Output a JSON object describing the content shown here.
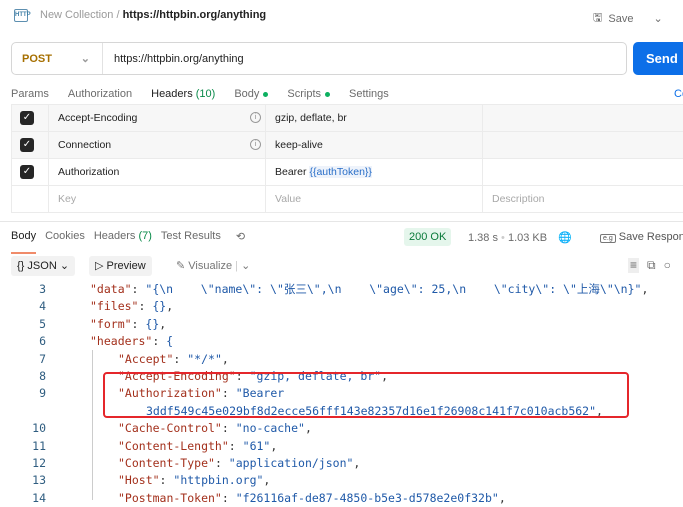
{
  "header": {
    "collection": "New Collection",
    "separator": "/",
    "request_name": "https://httpbin.org/anything",
    "save_label": "Save",
    "http_badge": "HTTP"
  },
  "request": {
    "method": "POST",
    "url": "https://httpbin.org/anything",
    "send_label": "Send"
  },
  "req_tabs": [
    {
      "label": "Params"
    },
    {
      "label": "Authorization"
    },
    {
      "label": "Headers",
      "count": "(10)"
    },
    {
      "label": "Body"
    },
    {
      "label": "Scripts"
    },
    {
      "label": "Settings"
    }
  ],
  "cookies_label": "Co",
  "headers_table": {
    "rows": [
      {
        "key": "Accept-Encoding",
        "value": "gzip, deflate, br"
      },
      {
        "key": "Connection",
        "value": "keep-alive"
      },
      {
        "key": "Authorization",
        "value": "Bearer",
        "variable": "{{authToken}}"
      }
    ],
    "placeholder": {
      "key": "Key",
      "value": "Value",
      "description": "Description"
    }
  },
  "resp_tabs": [
    {
      "label": "Body"
    },
    {
      "label": "Cookies"
    },
    {
      "label": "Headers",
      "count": "(7)"
    },
    {
      "label": "Test Results"
    }
  ],
  "response": {
    "status": "200 OK",
    "time": "1.38 s",
    "size": "1.03 KB",
    "save_label": "Save Respons"
  },
  "toolbar": {
    "format": "JSON",
    "preview": "Preview",
    "visualize": "Visualize"
  },
  "code_lines": [
    {
      "n": "3",
      "i": 0,
      "k": "\"data\"",
      "v": "\"{\\n    \\\"name\\\": \\\"张三\\\",\\n    \\\"age\\\": 25,\\n    \\\"city\\\": \\\"上海\\\"\\n}\"",
      "s": ","
    },
    {
      "n": "4",
      "i": 0,
      "k": "\"files\"",
      "v": "{}",
      "s": ","
    },
    {
      "n": "5",
      "i": 0,
      "k": "\"form\"",
      "v": "{}",
      "s": ","
    },
    {
      "n": "6",
      "i": 0,
      "k": "\"headers\"",
      "v": "{",
      "s": ""
    },
    {
      "n": "7",
      "i": 1,
      "k": "\"Accept\"",
      "v": "\"*/*\"",
      "s": ","
    },
    {
      "n": "8",
      "i": 1,
      "k": "\"Accept-Encoding\"",
      "v": "\"gzip, deflate, br\"",
      "s": ","
    },
    {
      "n": "9",
      "i": 1,
      "k": "\"Authorization\"",
      "v": "\"Bearer",
      "s": ""
    },
    {
      "n": "",
      "i": 2,
      "k": "",
      "v": "3ddf549c45e029bf8d2ecce56fff143e82357d16e1f26908c141f7c010acb562\"",
      "s": ","
    },
    {
      "n": "10",
      "i": 1,
      "k": "\"Cache-Control\"",
      "v": "\"no-cache\"",
      "s": ","
    },
    {
      "n": "11",
      "i": 1,
      "k": "\"Content-Length\"",
      "v": "\"61\"",
      "s": ","
    },
    {
      "n": "12",
      "i": 1,
      "k": "\"Content-Type\"",
      "v": "\"application/json\"",
      "s": ","
    },
    {
      "n": "13",
      "i": 1,
      "k": "\"Host\"",
      "v": "\"httpbin.org\"",
      "s": ","
    },
    {
      "n": "14",
      "i": 1,
      "k": "\"Postman-Token\"",
      "v": "\"f26116af-de87-4850-b5e3-d578e2e0f32b\"",
      "s": ","
    }
  ]
}
